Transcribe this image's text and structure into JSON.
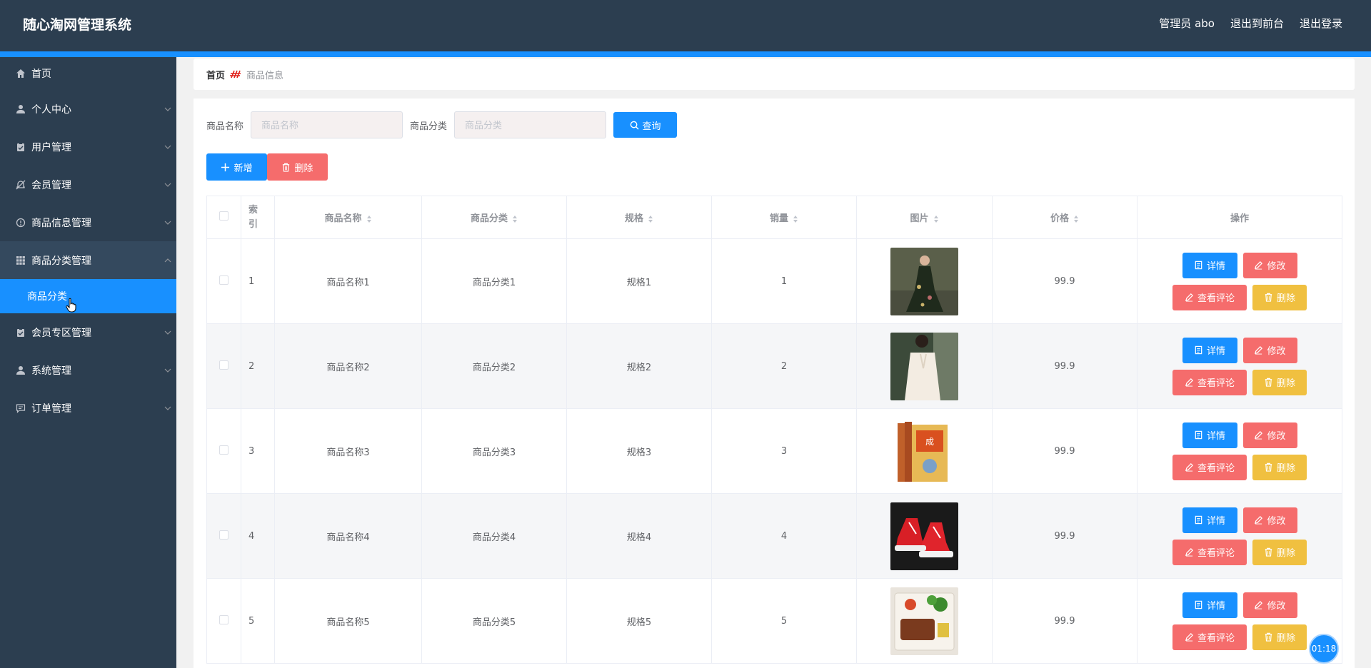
{
  "header": {
    "title": "随心淘网管理系统",
    "admin": "管理员 abo",
    "to_frontend": "退出到前台",
    "logout": "退出登录"
  },
  "sidebar": {
    "items": [
      {
        "label": "首页",
        "icon": "home-icon"
      },
      {
        "label": "个人中心",
        "icon": "user-icon"
      },
      {
        "label": "用户管理",
        "icon": "clipboard-icon"
      },
      {
        "label": "会员管理",
        "icon": "bell-off-icon"
      },
      {
        "label": "商品信息管理",
        "icon": "info-icon"
      },
      {
        "label": "商品分类管理",
        "icon": "grid-icon"
      },
      {
        "label": "会员专区管理",
        "icon": "clipboard-icon"
      },
      {
        "label": "系统管理",
        "icon": "user-icon"
      },
      {
        "label": "订单管理",
        "icon": "chat-icon"
      }
    ],
    "sub_item": "商品分类"
  },
  "breadcrumb": {
    "home": "首页",
    "current": "商品信息"
  },
  "search": {
    "name_label": "商品名称",
    "name_placeholder": "商品名称",
    "cat_label": "商品分类",
    "cat_placeholder": "商品分类",
    "query_label": "查询"
  },
  "actions": {
    "add": "新增",
    "delete": "删除"
  },
  "table": {
    "headers": {
      "index": "索引",
      "name": "商品名称",
      "category": "商品分类",
      "spec": "规格",
      "sales": "销量",
      "image": "图片",
      "price": "价格",
      "ops": "操作"
    },
    "buttons": {
      "detail": "详情",
      "edit": "修改",
      "review": "查看评论",
      "remove": "删除"
    },
    "rows": [
      {
        "index": "1",
        "name": "商品名称1",
        "category": "商品分类1",
        "spec": "规格1",
        "sales": "1",
        "price": "99.9",
        "image": "dress-photo"
      },
      {
        "index": "2",
        "name": "商品名称2",
        "category": "商品分类2",
        "spec": "规格2",
        "sales": "2",
        "price": "99.9",
        "image": "blouse-photo"
      },
      {
        "index": "3",
        "name": "商品名称3",
        "category": "商品分类3",
        "spec": "规格3",
        "sales": "3",
        "price": "99.9",
        "image": "book-photo"
      },
      {
        "index": "4",
        "name": "商品名称4",
        "category": "商品分类4",
        "spec": "规格4",
        "sales": "4",
        "price": "99.9",
        "image": "sneakers-photo"
      },
      {
        "index": "5",
        "name": "商品名称5",
        "category": "商品分类5",
        "spec": "规格5",
        "sales": "5",
        "price": "99.9",
        "image": "food-photo"
      }
    ]
  },
  "timer": "01:18"
}
